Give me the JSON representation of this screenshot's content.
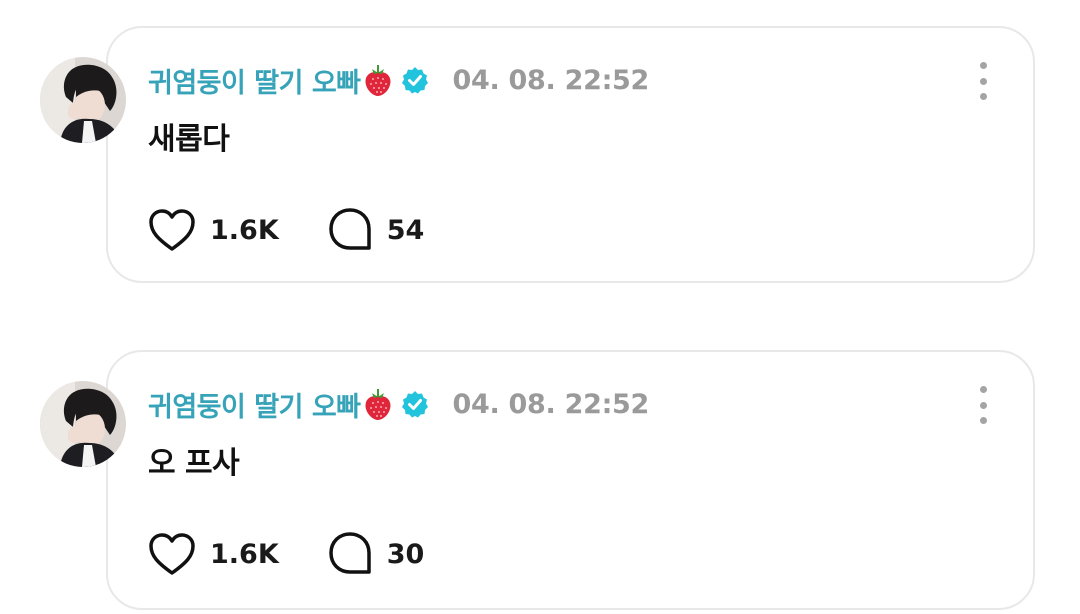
{
  "posts": [
    {
      "author": "귀염둥이 딸기 오빠",
      "timestamp": "04. 08. 22:52",
      "content": "새롭다",
      "likes": "1.6K",
      "comments": "54",
      "icons": {
        "badge": "strawberry-icon",
        "verified": "verified-icon",
        "like": "heart-icon",
        "comment": "comment-icon",
        "menu": "more-vertical-icon"
      }
    },
    {
      "author": "귀염둥이 딸기 오빠",
      "timestamp": "04. 08. 22:52",
      "content": "오 프사",
      "likes": "1.6K",
      "comments": "30",
      "icons": {
        "badge": "strawberry-icon",
        "verified": "verified-icon",
        "like": "heart-icon",
        "comment": "comment-icon",
        "menu": "more-vertical-icon"
      }
    }
  ],
  "colors": {
    "author": "#36a3b8",
    "verified": "#22c3dc",
    "timestamp": "#9a9a9a",
    "card_border": "#e8e8e8"
  }
}
